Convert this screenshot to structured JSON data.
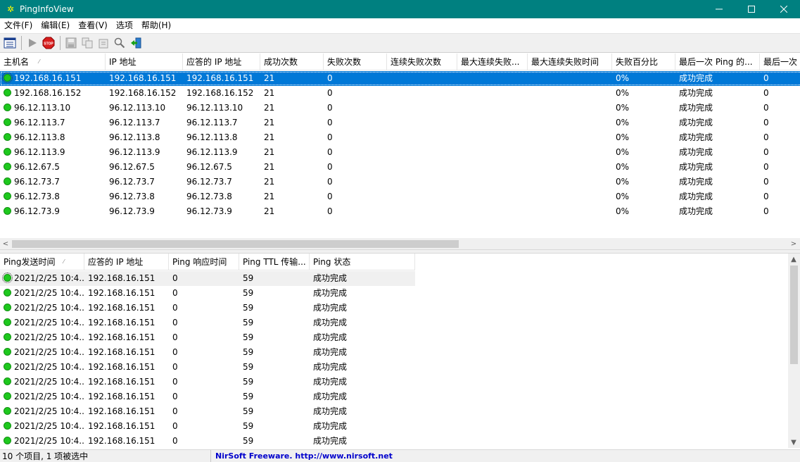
{
  "window": {
    "title": "PingInfoView"
  },
  "menu": [
    "文件(F)",
    "编辑(E)",
    "查看(V)",
    "选项",
    "帮助(H)"
  ],
  "toolbar": {
    "buttons": [
      {
        "icon": "options-list-icon",
        "enabled": true
      },
      {
        "icon": "play-icon",
        "enabled": false
      },
      {
        "icon": "stop-icon",
        "label": "STOP",
        "enabled": true
      },
      {
        "icon": "save-icon",
        "enabled": false
      },
      {
        "icon": "copy-icon",
        "enabled": false
      },
      {
        "icon": "properties-icon",
        "enabled": false
      },
      {
        "icon": "find-icon",
        "enabled": true
      },
      {
        "icon": "exit-icon",
        "enabled": true
      }
    ]
  },
  "top_table": {
    "columns": [
      "主机名",
      "IP 地址",
      "应答的 IP 地址",
      "成功次数",
      "失败次数",
      "连续失败次数",
      "最大连续失败...",
      "最大连续失败时间",
      "失败百分比",
      "最后一次 Ping 的...",
      "最后一次"
    ],
    "rows": [
      [
        "192.168.16.151",
        "192.168.16.151",
        "192.168.16.151",
        "21",
        "0",
        "",
        "",
        "",
        "0%",
        "成功完成",
        "0"
      ],
      [
        "192.168.16.152",
        "192.168.16.152",
        "192.168.16.152",
        "21",
        "0",
        "",
        "",
        "",
        "0%",
        "成功完成",
        "0"
      ],
      [
        "96.12.113.10",
        "96.12.113.10",
        "96.12.113.10",
        "21",
        "0",
        "",
        "",
        "",
        "0%",
        "成功完成",
        "0"
      ],
      [
        "96.12.113.7",
        "96.12.113.7",
        "96.12.113.7",
        "21",
        "0",
        "",
        "",
        "",
        "0%",
        "成功完成",
        "0"
      ],
      [
        "96.12.113.8",
        "96.12.113.8",
        "96.12.113.8",
        "21",
        "0",
        "",
        "",
        "",
        "0%",
        "成功完成",
        "0"
      ],
      [
        "96.12.113.9",
        "96.12.113.9",
        "96.12.113.9",
        "21",
        "0",
        "",
        "",
        "",
        "0%",
        "成功完成",
        "0"
      ],
      [
        "96.12.67.5",
        "96.12.67.5",
        "96.12.67.5",
        "21",
        "0",
        "",
        "",
        "",
        "0%",
        "成功完成",
        "0"
      ],
      [
        "96.12.73.7",
        "96.12.73.7",
        "96.12.73.7",
        "21",
        "0",
        "",
        "",
        "",
        "0%",
        "成功完成",
        "0"
      ],
      [
        "96.12.73.8",
        "96.12.73.8",
        "96.12.73.8",
        "21",
        "0",
        "",
        "",
        "",
        "0%",
        "成功完成",
        "0"
      ],
      [
        "96.12.73.9",
        "96.12.73.9",
        "96.12.73.9",
        "21",
        "0",
        "",
        "",
        "",
        "0%",
        "成功完成",
        "0"
      ]
    ],
    "selected_row": 0
  },
  "bottom_table": {
    "columns": [
      "Ping发送时间",
      "应答的 IP 地址",
      "Ping 响应时间",
      "Ping TTL 传输...",
      "Ping 状态"
    ],
    "rows": [
      [
        "2021/2/25 10:4...",
        "192.168.16.151",
        "0",
        "59",
        "成功完成"
      ],
      [
        "2021/2/25 10:4...",
        "192.168.16.151",
        "0",
        "59",
        "成功完成"
      ],
      [
        "2021/2/25 10:4...",
        "192.168.16.151",
        "0",
        "59",
        "成功完成"
      ],
      [
        "2021/2/25 10:4...",
        "192.168.16.151",
        "0",
        "59",
        "成功完成"
      ],
      [
        "2021/2/25 10:4...",
        "192.168.16.151",
        "0",
        "59",
        "成功完成"
      ],
      [
        "2021/2/25 10:4...",
        "192.168.16.151",
        "0",
        "59",
        "成功完成"
      ],
      [
        "2021/2/25 10:4...",
        "192.168.16.151",
        "0",
        "59",
        "成功完成"
      ],
      [
        "2021/2/25 10:4...",
        "192.168.16.151",
        "0",
        "59",
        "成功完成"
      ],
      [
        "2021/2/25 10:4...",
        "192.168.16.151",
        "0",
        "59",
        "成功完成"
      ],
      [
        "2021/2/25 10:4...",
        "192.168.16.151",
        "0",
        "59",
        "成功完成"
      ],
      [
        "2021/2/25 10:4...",
        "192.168.16.151",
        "0",
        "59",
        "成功完成"
      ],
      [
        "2021/2/25 10:4...",
        "192.168.16.151",
        "0",
        "59",
        "成功完成"
      ]
    ],
    "highlighted_row": 0
  },
  "status": {
    "items": "10 个项目, 1 项被选中",
    "credit": "NirSoft Freeware.  http://www.nirsoft.net"
  },
  "colors": {
    "titlebar": "#008080",
    "selection": "#0078d7",
    "status_ok": "#1ec81e"
  }
}
